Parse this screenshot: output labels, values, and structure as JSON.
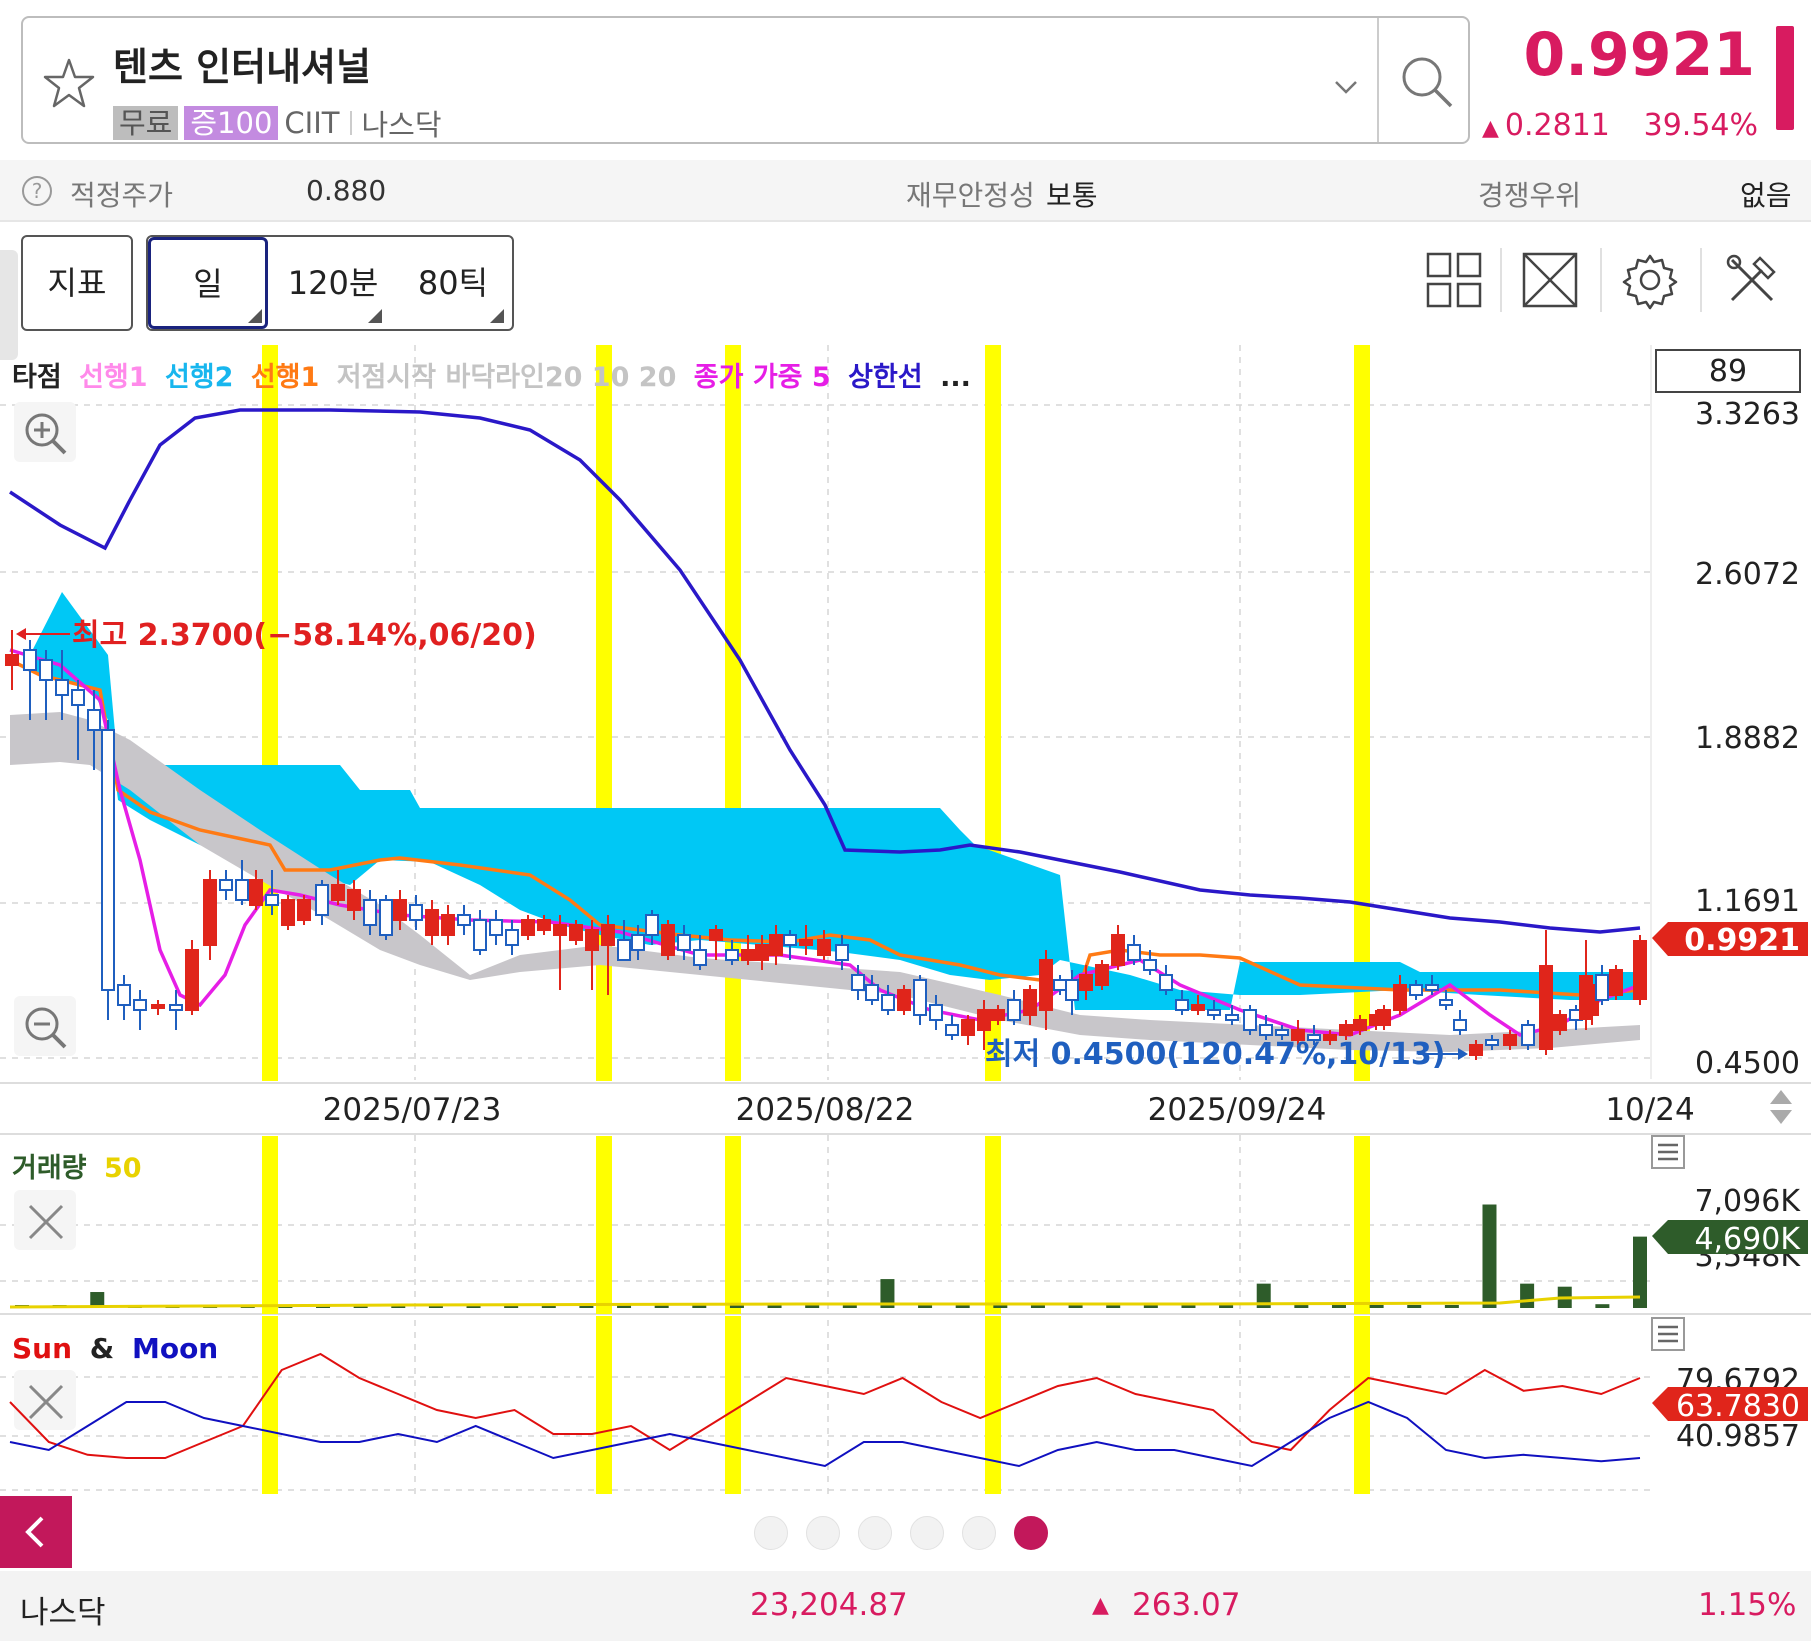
{
  "header": {
    "stock_name": "텐츠 인터내셔널",
    "tag_free": "무료",
    "tag_margin": "증100",
    "ticker": "CIIT",
    "exchange": "나스닥",
    "price": "0.9921",
    "change": "0.2811",
    "change_pct": "39.54%"
  },
  "info_bar": {
    "fair_price_label": "적정주가",
    "fair_price_value": "0.880",
    "stability_label": "재무안정성",
    "stability_value": "보통",
    "competitive_label": "경쟁우위",
    "competitive_value": "없음"
  },
  "toolbar": {
    "indicator_label": "지표",
    "period_day": "일",
    "period_120": "120분",
    "period_80": "80틱"
  },
  "colors": {
    "accent": "#d81b60",
    "up_candle": "#e0251b",
    "down_candle": "#1f5fbf",
    "cloud": "#00c8f5",
    "highlight": "#ffff00",
    "volume": "#2e5c2a",
    "sun": "#e01010",
    "moon": "#1010c0"
  },
  "icons": [
    "star-icon",
    "chevron-down-icon",
    "search-icon",
    "grid-icon",
    "expand-icon",
    "gear-icon",
    "tools-icon",
    "zoom-in-icon",
    "zoom-out-icon",
    "close-icon",
    "menu-icon",
    "back-icon",
    "help-icon",
    "up-triangle-icon"
  ],
  "chart_data": [
    {
      "type": "candlestick",
      "legend": {
        "t0": "타점",
        "t1": "선행1",
        "t2": "선행2",
        "t3": "선행1",
        "t4": "저점시작 바닥라인20 10 20",
        "t5": "종가 가중 5",
        "t6": "상한선",
        "t7": "..."
      },
      "indicator_box": "89",
      "y_ticks": [
        "3.3263",
        "2.6072",
        "1.8882",
        "1.1691",
        "0.4500"
      ],
      "current_price_label": "0.9921",
      "x_labels": [
        "2025/07/23",
        "2025/08/22",
        "2025/09/24",
        "10/24"
      ],
      "annotations": {
        "high": "최고 2.3700(−58.14%,06/20)",
        "low": "최저 0.4500(120.47%,10/13)"
      },
      "ylim": [
        0.45,
        3.3263
      ],
      "series": {
        "upper_band": [
          2.8,
          2.7,
          2.65,
          3.0,
          3.3,
          3.33,
          3.33,
          3.33,
          3.33,
          3.32,
          3.3,
          3.2,
          3.0,
          2.6,
          2.2,
          1.8,
          1.3,
          1.27,
          1.27,
          1.28,
          1.25,
          1.2,
          1.17,
          1.14,
          1.12,
          1.11,
          1.1,
          1.08,
          1.06,
          1.04,
          1.03,
          1.02
        ],
        "ichimoku_span_a_edge": [
          2.6,
          2.4,
          1.6,
          1.45,
          1.45,
          1.45,
          1.45,
          1.45,
          1.45,
          1.4,
          1.4,
          1.4,
          1.4,
          1.4,
          1.4,
          1.4,
          1.4,
          1.4,
          1.35,
          1.25,
          1.2,
          0.85,
          0.85,
          0.85,
          0.85,
          0.85,
          0.85,
          0.85,
          0.85,
          0.82,
          0.82,
          0.82
        ],
        "close_line": [
          2.2,
          2.1,
          0.7,
          1.0,
          1.05,
          1.0,
          0.95,
          0.92,
          0.9,
          0.88,
          0.87,
          0.86,
          0.86,
          0.85,
          0.84,
          0.84,
          0.84,
          0.84,
          0.72,
          0.62,
          0.58,
          0.65,
          0.7,
          0.72,
          0.64,
          0.56,
          0.55,
          0.58,
          0.66,
          0.6,
          0.65,
          0.7
        ]
      }
    },
    {
      "type": "bar",
      "title": "거래량",
      "ma_label": "50",
      "y_ticks": [
        "7,096K",
        "3,548K"
      ],
      "current_label": "4,690K",
      "values_k": [
        120,
        110,
        1050,
        90,
        80,
        80,
        70,
        70,
        70,
        70,
        60,
        60,
        60,
        60,
        60,
        70,
        60,
        60,
        60,
        60,
        80,
        100,
        90,
        1900,
        300,
        250,
        80,
        80,
        70,
        60,
        60,
        80,
        90,
        1600,
        300,
        180,
        80,
        70,
        150,
        6800,
        1600,
        1400,
        250,
        4690
      ]
    },
    {
      "type": "line",
      "title_sun": "Sun",
      "title_amp": "&",
      "title_moon": "Moon",
      "y_ticks": [
        "79.6792",
        "40.9857"
      ],
      "current_label": "63.7830",
      "series": [
        {
          "name": "Sun",
          "values": [
            55,
            30,
            22,
            20,
            20,
            30,
            40,
            75,
            85,
            70,
            60,
            50,
            45,
            50,
            35,
            35,
            40,
            25,
            40,
            55,
            70,
            65,
            60,
            70,
            55,
            45,
            55,
            65,
            70,
            60,
            55,
            50,
            30,
            25,
            50,
            70,
            65,
            60,
            75,
            62,
            65,
            60,
            70
          ]
        },
        {
          "name": "Moon",
          "values": [
            30,
            25,
            40,
            55,
            55,
            45,
            40,
            35,
            30,
            30,
            35,
            30,
            40,
            30,
            20,
            25,
            30,
            35,
            30,
            25,
            20,
            15,
            30,
            30,
            25,
            20,
            15,
            25,
            30,
            25,
            25,
            20,
            15,
            30,
            45,
            55,
            45,
            25,
            20,
            22,
            20,
            18,
            20
          ]
        }
      ]
    }
  ],
  "pager": {
    "count": 6,
    "active": 5
  },
  "footer": {
    "index_name": "나스닥",
    "index_value": "23,204.87",
    "index_change": "263.07",
    "index_pct": "1.15%"
  }
}
